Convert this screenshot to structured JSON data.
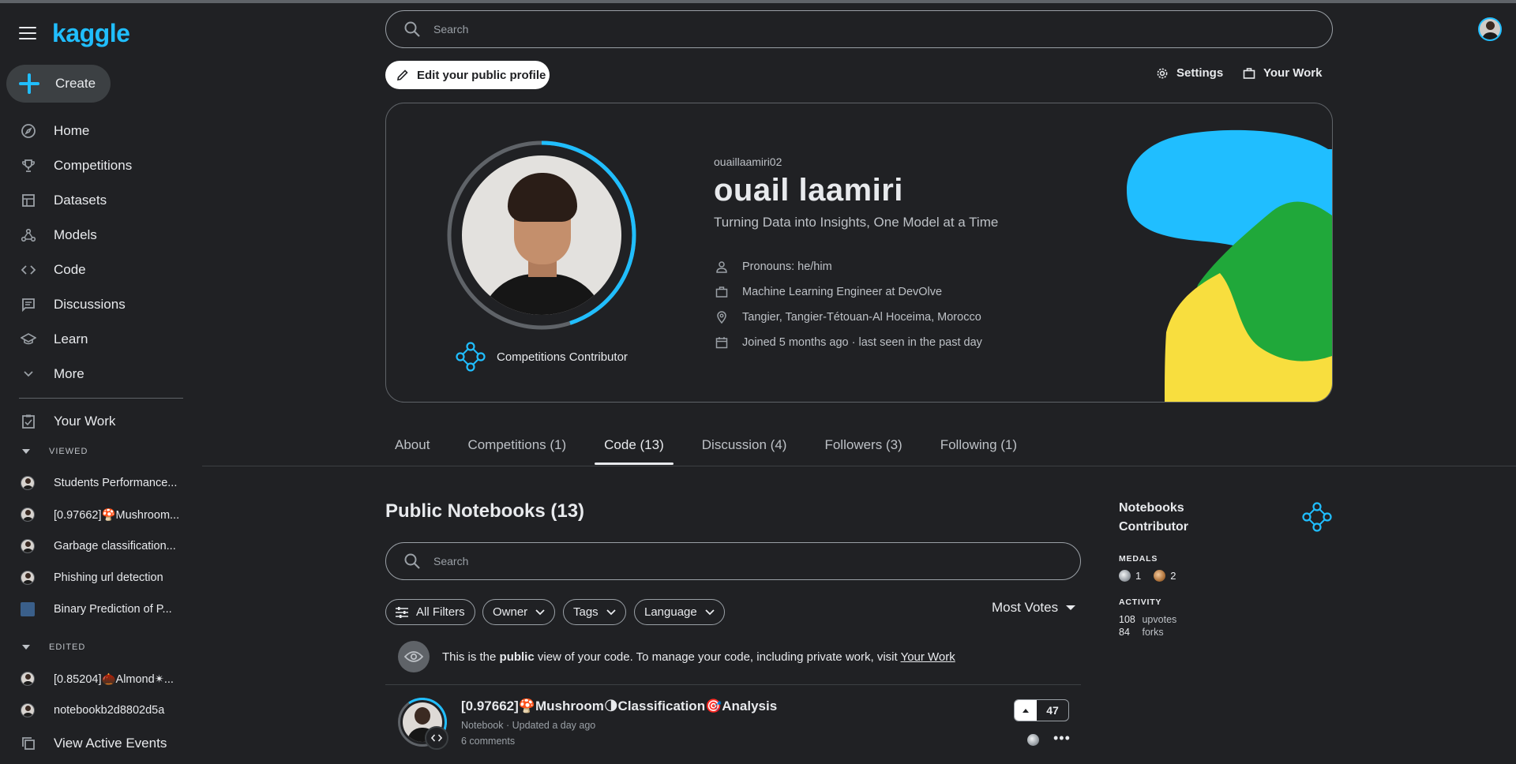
{
  "app": {
    "logo": "kaggle"
  },
  "sidebar": {
    "create_label": "Create",
    "nav": [
      {
        "label": "Home",
        "icon": "compass-icon"
      },
      {
        "label": "Competitions",
        "icon": "trophy-icon"
      },
      {
        "label": "Datasets",
        "icon": "table-icon"
      },
      {
        "label": "Models",
        "icon": "models-icon"
      },
      {
        "label": "Code",
        "icon": "code-icon"
      },
      {
        "label": "Discussions",
        "icon": "discussion-icon"
      },
      {
        "label": "Learn",
        "icon": "school-icon"
      },
      {
        "label": "More",
        "icon": "chevron-down-icon"
      }
    ],
    "your_work": "Your Work",
    "viewed_header": "VIEWED",
    "viewed": [
      "Students Performance...",
      "[0.97662]🍄Mushroom...",
      "Garbage classification...",
      "Phishing url detection",
      "Binary Prediction of P..."
    ],
    "edited_header": "EDITED",
    "edited": [
      "[0.85204]🌰Almond✴...",
      "notebookb2d8802d5a"
    ],
    "active_events": "View Active Events"
  },
  "header": {
    "search_placeholder": "Search",
    "edit_profile": "Edit your public profile",
    "settings": "Settings",
    "your_work": "Your Work"
  },
  "profile": {
    "username": "ouaillaamiri02",
    "name": "ouail laamiri",
    "bio": "Turning Data into Insights, One Model at a Time",
    "pronouns": "Pronouns: he/him",
    "occupation": "Machine Learning Engineer at DevOlve",
    "location": "Tangier, Tangier-Tétouan-Al Hoceima, Morocco",
    "joined": "Joined 5 months ago · last seen in the past day",
    "tier": "Competitions Contributor",
    "progress_fraction": 0.45,
    "colors": {
      "accent": "#20beff",
      "blob_blue": "#20beff",
      "blob_green": "#20a83a",
      "blob_yellow": "#f8de3e"
    }
  },
  "tabs": [
    {
      "label": "About",
      "active": false
    },
    {
      "label": "Competitions (1)",
      "active": false
    },
    {
      "label": "Code (13)",
      "active": true
    },
    {
      "label": "Discussion (4)",
      "active": false
    },
    {
      "label": "Followers (3)",
      "active": false
    },
    {
      "label": "Following (1)",
      "active": false
    }
  ],
  "notebooks": {
    "title": "Public Notebooks (13)",
    "search_placeholder": "Search",
    "filters": {
      "all": "All Filters",
      "owner": "Owner",
      "tags": "Tags",
      "language": "Language"
    },
    "sort": "Most Votes",
    "note_prefix": "This is the ",
    "note_bold": "public",
    "note_mid": " view of your code. To manage your code, including private work, visit ",
    "note_link": "Your Work",
    "items": [
      {
        "title": "[0.97662]🍄Mushroom🌗Classification🎯Analysis",
        "meta": "Notebook · Updated a day ago",
        "comments": "6 comments",
        "votes": "47",
        "medal": "silver"
      }
    ]
  },
  "right_panel": {
    "title_line1": "Notebooks",
    "title_line2": "Contributor",
    "medals_header": "MEDALS",
    "silver_count": "1",
    "bronze_count": "2",
    "activity_header": "ACTIVITY",
    "upvotes_value": "108",
    "upvotes_label": "upvotes",
    "forks_value": "84",
    "forks_label": "forks"
  }
}
